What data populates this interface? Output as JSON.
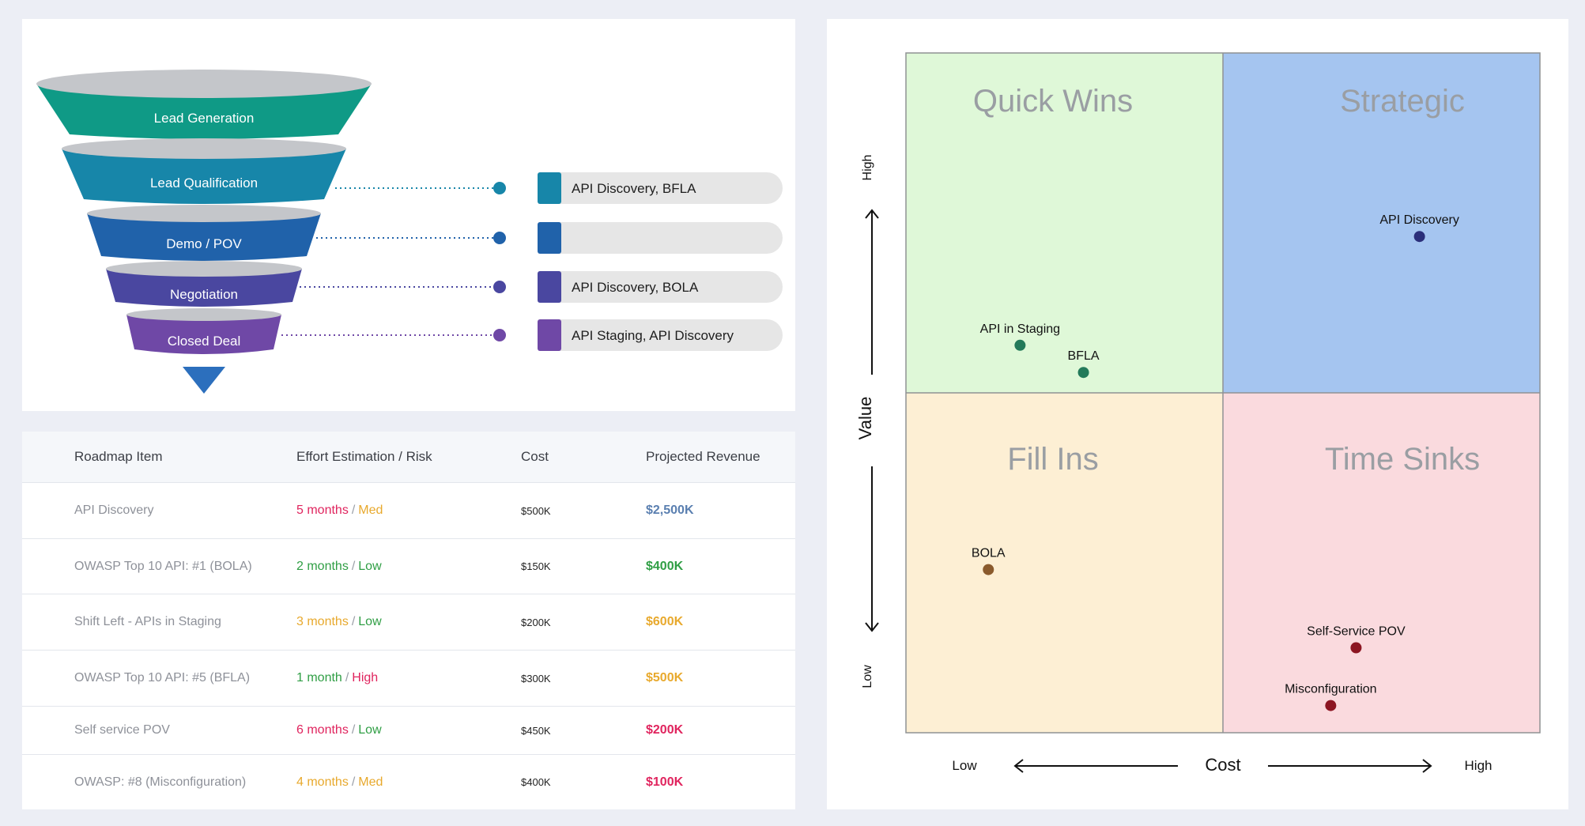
{
  "funnel": {
    "stages": [
      {
        "label": "Lead Generation",
        "color": "#0f9a86"
      },
      {
        "label": "Lead Qualification",
        "color": "#1786a9"
      },
      {
        "label": "Demo / POV",
        "color": "#2062aa"
      },
      {
        "label": "Negotiation",
        "color": "#4a47a0"
      },
      {
        "label": "Closed Deal",
        "color": "#6f48a6"
      }
    ],
    "tip_color": "#2c6fbd",
    "tags": [
      {
        "stage": "Lead Qualification",
        "text": "API Discovery, BFLA",
        "color": "#1786a9"
      },
      {
        "stage": "Demo / POV",
        "text": "",
        "color": "#2062aa"
      },
      {
        "stage": "Negotiation",
        "text": "API Discovery, BOLA",
        "color": "#4a47a0"
      },
      {
        "stage": "Closed Deal",
        "text": "API Staging, API Discovery",
        "color": "#6f48a6"
      }
    ]
  },
  "table": {
    "headers": {
      "item": "Roadmap Item",
      "effort": "Effort Estimation / Risk",
      "cost": "Cost",
      "revenue": "Projected Revenue"
    },
    "rows": [
      {
        "item": "API Discovery",
        "duration": "5 months",
        "duration_color": "#e0245e",
        "risk": "Med",
        "risk_color": "#e8a92d",
        "cost": "$500K",
        "revenue": "$2,500K",
        "revenue_color": "#5a7fb0"
      },
      {
        "item": "OWASP Top 10 API: #1 (BOLA)",
        "duration": "2 months",
        "duration_color": "#2f9e44",
        "risk": "Low",
        "risk_color": "#2f9e44",
        "cost": "$150K",
        "revenue": "$400K",
        "revenue_color": "#2f9e44"
      },
      {
        "item": "Shift Left - APIs in Staging",
        "duration": "3 months",
        "duration_color": "#e8a92d",
        "risk": "Low",
        "risk_color": "#2f9e44",
        "cost": "$200K",
        "revenue": "$600K",
        "revenue_color": "#e8a92d"
      },
      {
        "item": "OWASP Top 10 API: #5 (BFLA)",
        "duration": "1 month",
        "duration_color": "#2f9e44",
        "risk": "High",
        "risk_color": "#e0245e",
        "cost": "$300K",
        "revenue": "$500K",
        "revenue_color": "#e8a92d"
      },
      {
        "item": "Self service POV",
        "duration": "6 months",
        "duration_color": "#e0245e",
        "risk": "Low",
        "risk_color": "#2f9e44",
        "cost": "$450K",
        "revenue": "$200K",
        "revenue_color": "#e0245e"
      },
      {
        "item": "OWASP: #8 (Misconfiguration)",
        "duration": "4 months",
        "duration_color": "#e8a92d",
        "risk": "Med",
        "risk_color": "#e8a92d",
        "cost": "$400K",
        "revenue": "$100K",
        "revenue_color": "#e0245e"
      }
    ]
  },
  "matrix": {
    "quadrants": {
      "quick_wins": {
        "label": "Quick Wins",
        "color": "#dff8d8"
      },
      "strategic": {
        "label": "Strategic",
        "color": "#a5c5f0"
      },
      "fill_ins": {
        "label": "Fill Ins",
        "color": "#fdefd4"
      },
      "time_sinks": {
        "label": "Time Sinks",
        "color": "#fadade"
      }
    },
    "x_axis": {
      "label": "Cost",
      "low": "Low",
      "high": "High"
    },
    "y_axis": {
      "label": "Value",
      "low": "Low",
      "high": "High"
    },
    "points": [
      {
        "label": "API Discovery",
        "cost": 0.81,
        "value": 0.73,
        "color": "#2b2f7a"
      },
      {
        "label": "API in Staging",
        "cost": 0.18,
        "value": 0.57,
        "color": "#237a5a"
      },
      {
        "label": "BFLA",
        "cost": 0.28,
        "value": 0.53,
        "color": "#237a5a"
      },
      {
        "label": "BOLA",
        "cost": 0.13,
        "value": 0.24,
        "color": "#8a5a2c"
      },
      {
        "label": "Self-Service POV",
        "cost": 0.71,
        "value": 0.125,
        "color": "#8c1522"
      },
      {
        "label": "Misconfiguration",
        "cost": 0.67,
        "value": 0.04,
        "color": "#8c1522"
      }
    ]
  }
}
